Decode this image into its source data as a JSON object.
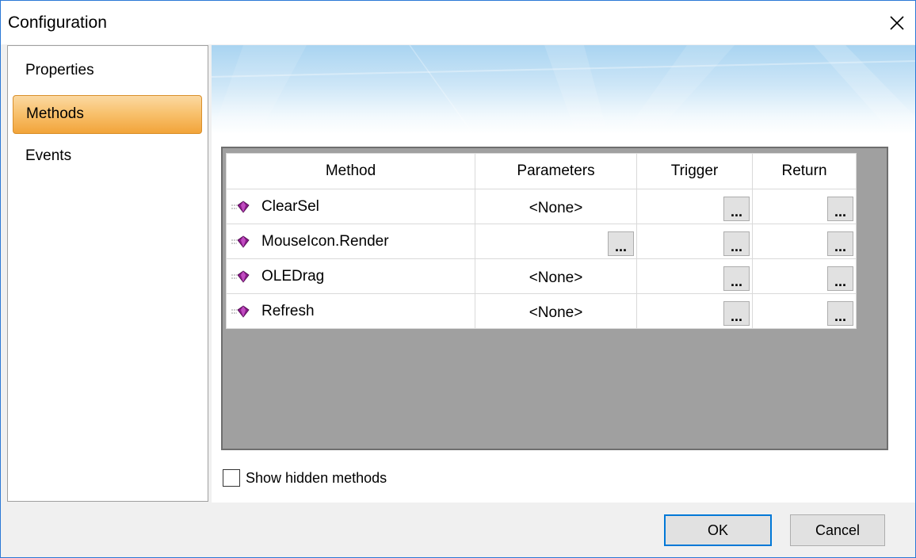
{
  "window": {
    "title": "Configuration"
  },
  "sidebar": {
    "items": [
      {
        "label": "Properties",
        "selected": false
      },
      {
        "label": "Methods",
        "selected": true
      },
      {
        "label": "Events",
        "selected": false
      }
    ]
  },
  "grid": {
    "columns": [
      "Method",
      "Parameters",
      "Trigger",
      "Return"
    ],
    "rows": [
      {
        "method": "ClearSel",
        "parameters": "<None>",
        "has_param_button": false
      },
      {
        "method": "MouseIcon.Render",
        "parameters": "",
        "has_param_button": true
      },
      {
        "method": "OLEDrag",
        "parameters": "<None>",
        "has_param_button": false
      },
      {
        "method": "Refresh",
        "parameters": "<None>",
        "has_param_button": false
      }
    ],
    "ellipsis_label": "...",
    "icon": "method-gem-icon",
    "icon_color": "#8b1a8b"
  },
  "options": {
    "show_hidden_label": "Show hidden methods",
    "show_hidden_checked": false
  },
  "buttons": {
    "ok": "OK",
    "cancel": "Cancel"
  },
  "colors": {
    "accent": "#0078d7",
    "selected_tab": "#f8c26f",
    "grid_background": "#a0a0a0"
  }
}
